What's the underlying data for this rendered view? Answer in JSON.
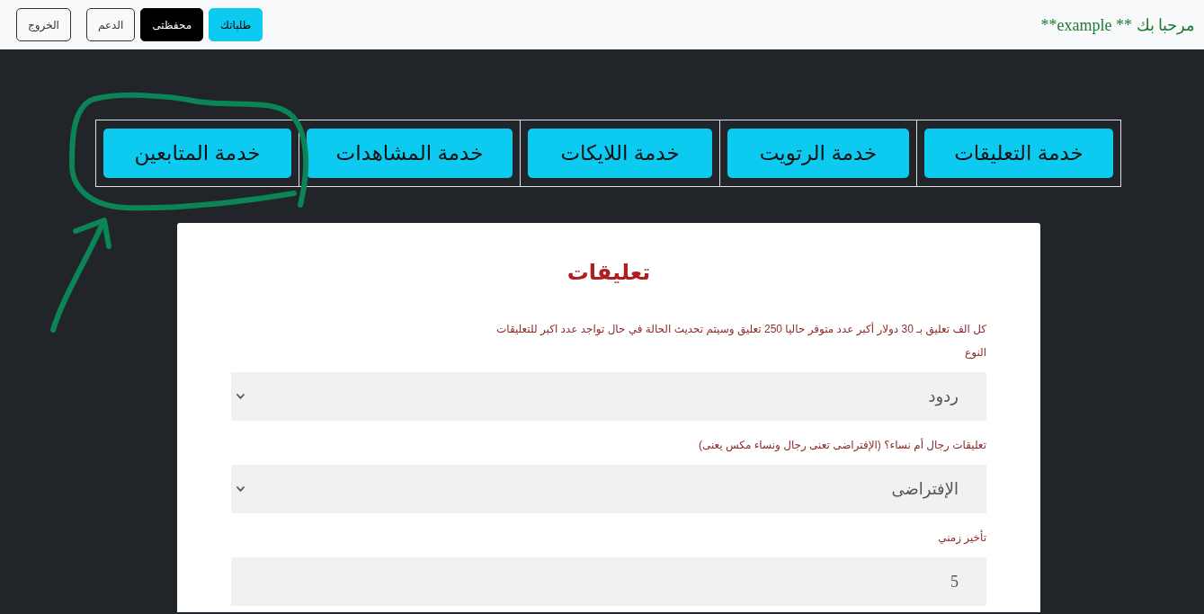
{
  "navbar": {
    "greeting": "مرحبا بك ** example**",
    "buttons": [
      {
        "label": "طلباتك",
        "kind": "info"
      },
      {
        "label": "محفظتى",
        "kind": "dark"
      },
      {
        "label": "الدعم",
        "kind": "outline"
      },
      {
        "label": "الخروج",
        "kind": "outline"
      }
    ]
  },
  "services": [
    {
      "label": "خدمة التعليقات",
      "circled": false
    },
    {
      "label": "خدمة الرتويت",
      "circled": false
    },
    {
      "label": "خدمة اللايكات",
      "circled": false
    },
    {
      "label": "خدمة المشاهدات",
      "circled": false
    },
    {
      "label": "خدمة المتابعين",
      "circled": true
    }
  ],
  "form": {
    "title": "تعليقات",
    "description": "كل الف تعليق بـ 30 دولار أكبر عدد متوفر حاليا 250 تعليق وسيتم تحديث الحالة في حال تواجد عدد اكبر للتعليقات",
    "fields": [
      {
        "kind": "select",
        "label": "النوع",
        "value": "ردود"
      },
      {
        "kind": "select",
        "label": "تعليقات رجال أم نساء؟ (الإفتراضى تعنى رجال ونساء مكس يعنى)",
        "value": "الإفتراضى"
      },
      {
        "kind": "input",
        "label": "تأخير زمني",
        "value": "5"
      }
    ]
  }
}
